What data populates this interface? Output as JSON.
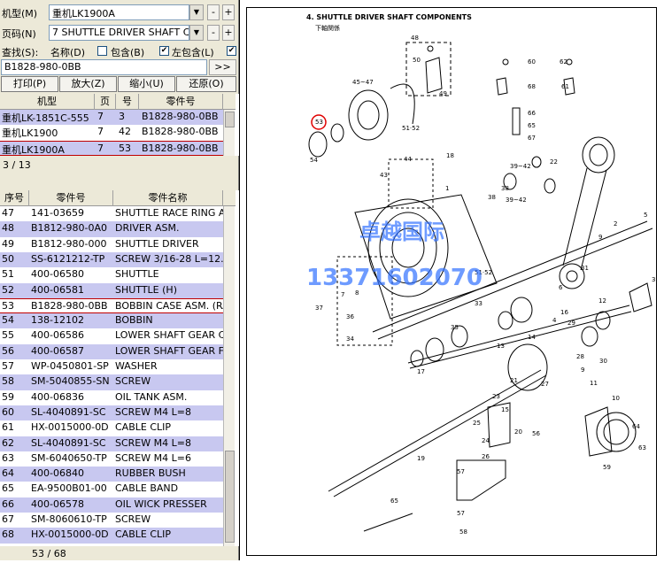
{
  "toolbar": {
    "model_label": "机型(M)",
    "model_value": "重机LK1900A",
    "page_label": "页码(N)",
    "page_value": "7 SHUTTLE DRIVER SHAFT CO",
    "find_label": "查找(S):",
    "opt_name": "名称(D)",
    "opt_contains": "包含(B)",
    "opt_left_contains": "左包含(L)",
    "search_value": "B1828-980-0BB",
    "go_label": ">>",
    "btn_print": "打印(P)",
    "btn_zoom_in": "放大(Z)",
    "btn_zoom_out": "缩小(U)",
    "btn_restore": "还原(O)"
  },
  "model_grid": {
    "headers": [
      "机型",
      "页",
      "号",
      "零件号"
    ],
    "rows": [
      [
        "重机LK-1851C-555",
        "7",
        "3",
        "B1828-980-0BB"
      ],
      [
        "重机LK1900",
        "7",
        "42",
        "B1828-980-0BB"
      ],
      [
        "重机LK1900A",
        "7",
        "53",
        "B1828-980-0BB"
      ]
    ],
    "count": "3 / 13"
  },
  "parts_grid": {
    "headers": [
      "序号",
      "零件号",
      "零件名称"
    ],
    "rows": [
      [
        "47",
        "141-03659",
        "SHUTTLE RACE RING A"
      ],
      [
        "48",
        "B1812-980-0A0",
        "DRIVER ASM."
      ],
      [
        "49",
        "B1812-980-000",
        "SHUTTLE DRIVER"
      ],
      [
        "50",
        "SS-6121212-TP",
        "SCREW 3/16-28 L=12.0"
      ],
      [
        "51",
        "400-06580",
        "SHUTTLE"
      ],
      [
        "52",
        "400-06581",
        "SHUTTLE (H)"
      ],
      [
        "53",
        "B1828-980-0BB",
        "BOBBIN CASE ASM. (RA"
      ],
      [
        "54",
        "138-12102",
        "BOBBIN"
      ],
      [
        "55",
        "400-06586",
        "LOWER SHAFT GEAR C"
      ],
      [
        "56",
        "400-06587",
        "LOWER SHAFT GEAR F"
      ],
      [
        "57",
        "WP-0450801-SP",
        "WASHER"
      ],
      [
        "58",
        "SM-5040855-SN",
        "SCREW"
      ],
      [
        "59",
        "400-06836",
        "OIL TANK ASM."
      ],
      [
        "60",
        "SL-4040891-SC",
        "SCREW M4 L=8"
      ],
      [
        "61",
        "HX-0015000-0D",
        "CABLE CLIP"
      ],
      [
        "62",
        "SL-4040891-SC",
        "SCREW M4 L=8"
      ],
      [
        "63",
        "SM-6040650-TP",
        "SCREW M4 L=6"
      ],
      [
        "64",
        "400-06840",
        "RUBBER BUSH"
      ],
      [
        "65",
        "EA-9500B01-00",
        "CABLE BAND"
      ],
      [
        "66",
        "400-06578",
        "OIL WICK PRESSER"
      ],
      [
        "67",
        "SM-8060610-TP",
        "SCREW"
      ],
      [
        "68",
        "HX-0015000-0D",
        "CABLE CLIP"
      ]
    ],
    "count": "53 / 68"
  },
  "diagram": {
    "title": "4. SHUTTLE DRIVER SHAFT COMPONENTS",
    "subtitle": "下軸関係",
    "watermark_name": "卓越国际",
    "watermark_phone": "13371602070",
    "callouts": [
      "48",
      "50",
      "49",
      "45~47",
      "51·52",
      "53",
      "54",
      "60",
      "68",
      "62",
      "61",
      "66",
      "65",
      "67",
      "44",
      "43",
      "18",
      "39~42",
      "22",
      "38",
      "38",
      "39~42",
      "1",
      "5",
      "2",
      "9",
      "51·52",
      "37",
      "7",
      "8",
      "36",
      "33",
      "6",
      "31",
      "34",
      "35",
      "3",
      "12",
      "14",
      "13",
      "4",
      "16",
      "29",
      "30",
      "11",
      "27",
      "15",
      "17",
      "28",
      "9",
      "19",
      "20",
      "21",
      "10",
      "64",
      "63",
      "59",
      "56",
      "65",
      "57",
      "58",
      "57",
      "26",
      "25",
      "24",
      "23"
    ]
  },
  "colors": {
    "selected_border": "#c00000",
    "alt_row": "#c8c8f0",
    "highlight_circle": "#e00000",
    "watermark": "#3070ff"
  }
}
